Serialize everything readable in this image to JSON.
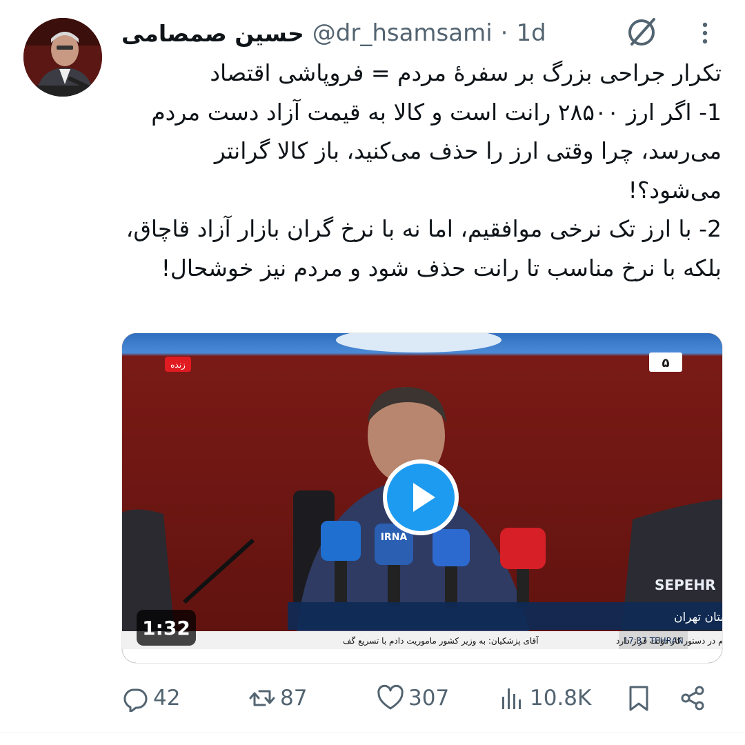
{
  "tweet": {
    "author_name": "حسین صمصامی",
    "handle": "@dr_hsamsami",
    "separator": "·",
    "time_ago": "1d",
    "lines": [
      "تکرار جراحی بزرگ بر سفرهٔ مردم = فروپاشی اقتصاد",
      "1- اگر ارز ۲۸۵۰۰ رانت است و کالا به قیمت آزاد دست مردم می‌رسد، چرا وقتی ارز را حذف می‌کنید، باز کالا گرانتر می‌شود؟!",
      "2- با ارز تک نرخی موافقیم، اما نه با نرخ گران بازار آزاد قاچاق، بلکه با نرخ مناسب تا رانت حذف شود و مردم نیز خوشحال!"
    ]
  },
  "video": {
    "live_badge": "زنده",
    "channel_logo": "۵",
    "mic_labels": [
      "IRNA"
    ],
    "watermark": "SEPEHR",
    "caption": "جمع‌بندی سفر معاون اجرایی رئیس جمهور به استان تهران",
    "ticker_left": "آقای پزشکیان: به وزیر کشور ماموریت دادم با تسریع گف",
    "ticker_right": "و حفظ قدرت خرید مردم در دستور کار دولت قرار دارد",
    "ticker_time": "17:37 TEHRAN",
    "duration": "1:32"
  },
  "actions": {
    "replies": "42",
    "reposts": "87",
    "likes": "307",
    "views": "10.8K"
  },
  "colors": {
    "accent": "#1d9bf0",
    "text": "#0f1419",
    "muted": "#536471",
    "video_bg": "#6e1512"
  },
  "icons": [
    "grok-icon",
    "more-icon",
    "reply-icon",
    "repost-icon",
    "like-icon",
    "views-icon",
    "bookmark-icon",
    "share-icon",
    "play-icon"
  ]
}
